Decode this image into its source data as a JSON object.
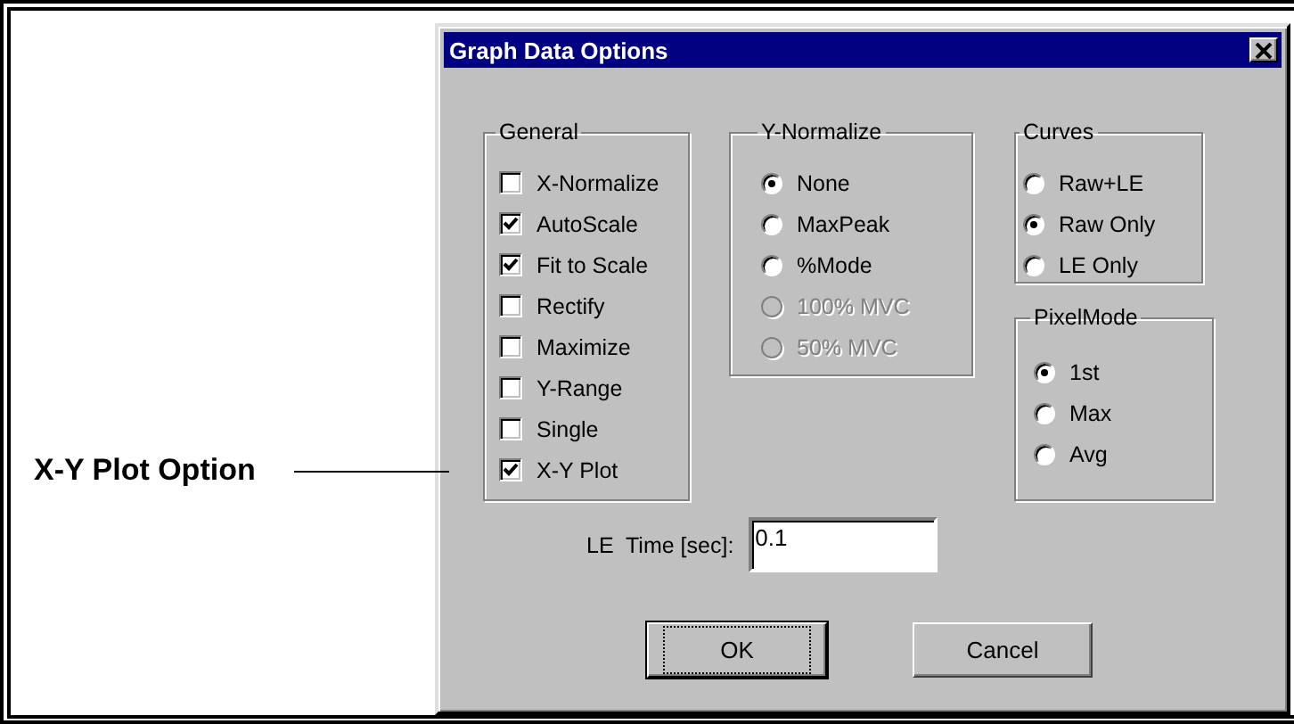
{
  "callout": {
    "label": "X-Y Plot Option"
  },
  "dialog": {
    "title": "Graph Data Options",
    "groups": [
      {
        "title": "General",
        "kind": "checkbox",
        "items": [
          {
            "label": "X-Normalize",
            "checked": false
          },
          {
            "label": "AutoScale",
            "checked": true
          },
          {
            "label": "Fit to Scale",
            "checked": true
          },
          {
            "label": "Rectify",
            "checked": false
          },
          {
            "label": "Maximize",
            "checked": false
          },
          {
            "label": "Y-Range",
            "checked": false
          },
          {
            "label": "Single",
            "checked": false
          },
          {
            "label": "X-Y Plot",
            "checked": true
          }
        ]
      },
      {
        "title": "Y-Normalize",
        "kind": "radio",
        "items": [
          {
            "label": "None",
            "selected": true,
            "disabled": false
          },
          {
            "label": "MaxPeak",
            "selected": false,
            "disabled": false
          },
          {
            "label": "%Mode",
            "selected": false,
            "disabled": false
          },
          {
            "label": "100% MVC",
            "selected": false,
            "disabled": true
          },
          {
            "label": "50% MVC",
            "selected": false,
            "disabled": true
          }
        ]
      },
      {
        "title": "Curves",
        "kind": "radio",
        "items": [
          {
            "label": "Raw+LE",
            "selected": false
          },
          {
            "label": "Raw Only",
            "selected": true
          },
          {
            "label": "LE Only",
            "selected": false
          }
        ]
      },
      {
        "title": "PixelMode",
        "kind": "radio",
        "items": [
          {
            "label": "1st",
            "selected": true
          },
          {
            "label": "Max",
            "selected": false
          },
          {
            "label": "Avg",
            "selected": false
          }
        ]
      }
    ],
    "le_time": {
      "label": "LE  Time [sec]:",
      "value": "0.1"
    },
    "buttons": [
      {
        "label": "OK",
        "focused": true
      },
      {
        "label": "Cancel",
        "focused": false
      }
    ]
  }
}
